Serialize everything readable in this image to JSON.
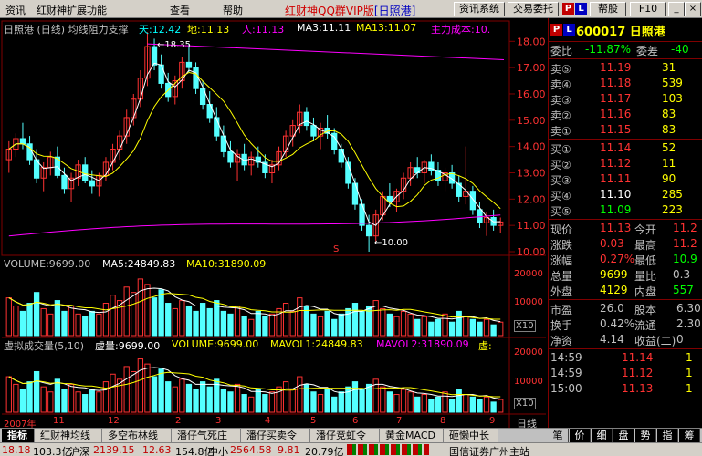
{
  "menu": {
    "items": [
      "资讯",
      "红财神扩展功能",
      "查看",
      "帮助"
    ],
    "caption_brand": "红财神QQ群VIP版",
    "caption_stock": "[日照港]",
    "buttons": [
      "资讯系统",
      "交易委托",
      "帮股",
      "F10"
    ],
    "p_badge": "P",
    "l_badge": "L"
  },
  "chart": {
    "title": "日照港 (日线) 均线阻力支撑",
    "legend": {
      "sky": "天:12.42",
      "earth": "地:11.13",
      "person": "人:11.13",
      "ma3": "MA3:11.11",
      "ma13": "MA13:11.07",
      "cost": "主力成本:10."
    },
    "price_axis": [
      "18.00",
      "17.00",
      "16.00",
      "15.00",
      "14.00",
      "13.00",
      "12.00",
      "11.00",
      "10.00"
    ],
    "high_label": "18.35",
    "low_label": "10.00",
    "marker_s": "S",
    "volume_legend": {
      "volume": "VOLUME:9699.00",
      "ma5": "MA5:24849.83",
      "ma10": "MA10:31890.09"
    },
    "volume_axis": [
      "20000",
      "10000"
    ],
    "volume_unit": "X10",
    "virtual_legend": {
      "title": "虚拟成交量(5,10)",
      "vol": "虚量:9699.00",
      "volume": "VOLUME:9699.00",
      "mavol1": "MAVOL1:24849.83",
      "mavol2": "MAVOL2:31890.09",
      "xu": "虚:"
    },
    "virtual_axis": [
      "20000",
      "10000"
    ],
    "virtual_unit": "X10",
    "date_labels": [
      "2007年",
      "11",
      "12",
      "2",
      "3",
      "4",
      "5",
      "6",
      "7",
      "8",
      "9"
    ],
    "period_label": "日线",
    "colors": {
      "up": "#ff3232",
      "down": "#54ffff",
      "ma_white": "#ffffff",
      "ma_yellow": "#ffff00",
      "ma_magenta": "#ff00ff"
    }
  },
  "chart_data": {
    "type": "candlestick",
    "title": "",
    "ylim": [
      10,
      18.6
    ],
    "volume_ylim": [
      0,
      23000
    ],
    "candles": [
      {
        "o": 13.5,
        "h": 14.2,
        "l": 13.0,
        "c": 13.9
      },
      {
        "o": 13.9,
        "h": 14.5,
        "l": 13.6,
        "c": 14.3
      },
      {
        "o": 14.3,
        "h": 14.9,
        "l": 13.9,
        "c": 14.1
      },
      {
        "o": 14.1,
        "h": 14.4,
        "l": 13.3,
        "c": 13.5
      },
      {
        "o": 13.5,
        "h": 13.9,
        "l": 12.6,
        "c": 12.8
      },
      {
        "o": 12.8,
        "h": 13.4,
        "l": 12.3,
        "c": 13.2
      },
      {
        "o": 13.2,
        "h": 13.8,
        "l": 12.9,
        "c": 13.6
      },
      {
        "o": 13.6,
        "h": 14.0,
        "l": 12.8,
        "c": 12.9
      },
      {
        "o": 12.9,
        "h": 13.2,
        "l": 12.2,
        "c": 12.4
      },
      {
        "o": 12.4,
        "h": 13.0,
        "l": 11.9,
        "c": 12.8
      },
      {
        "o": 12.8,
        "h": 13.5,
        "l": 12.5,
        "c": 13.3
      },
      {
        "o": 13.3,
        "h": 13.6,
        "l": 12.6,
        "c": 12.7
      },
      {
        "o": 12.7,
        "h": 13.1,
        "l": 12.2,
        "c": 12.5
      },
      {
        "o": 12.5,
        "h": 13.0,
        "l": 12.1,
        "c": 12.9
      },
      {
        "o": 12.9,
        "h": 13.6,
        "l": 12.7,
        "c": 13.4
      },
      {
        "o": 13.4,
        "h": 14.1,
        "l": 13.1,
        "c": 13.9
      },
      {
        "o": 13.9,
        "h": 14.6,
        "l": 13.5,
        "c": 14.4
      },
      {
        "o": 14.4,
        "h": 15.4,
        "l": 14.1,
        "c": 15.1
      },
      {
        "o": 15.1,
        "h": 16.0,
        "l": 14.8,
        "c": 15.8
      },
      {
        "o": 15.8,
        "h": 16.9,
        "l": 15.5,
        "c": 16.6
      },
      {
        "o": 16.6,
        "h": 18.35,
        "l": 16.3,
        "c": 17.8
      },
      {
        "o": 17.8,
        "h": 18.1,
        "l": 16.9,
        "c": 17.1
      },
      {
        "o": 17.1,
        "h": 17.5,
        "l": 16.2,
        "c": 16.4
      },
      {
        "o": 16.4,
        "h": 16.8,
        "l": 15.7,
        "c": 15.9
      },
      {
        "o": 15.9,
        "h": 16.7,
        "l": 15.6,
        "c": 16.5
      },
      {
        "o": 16.5,
        "h": 17.4,
        "l": 16.2,
        "c": 17.2
      },
      {
        "o": 17.2,
        "h": 17.9,
        "l": 16.8,
        "c": 17.0
      },
      {
        "o": 17.0,
        "h": 17.2,
        "l": 16.0,
        "c": 16.2
      },
      {
        "o": 16.2,
        "h": 16.5,
        "l": 15.4,
        "c": 15.6
      },
      {
        "o": 15.6,
        "h": 16.1,
        "l": 14.9,
        "c": 15.1
      },
      {
        "o": 15.1,
        "h": 15.5,
        "l": 14.2,
        "c": 14.4
      },
      {
        "o": 14.4,
        "h": 14.8,
        "l": 13.6,
        "c": 13.8
      },
      {
        "o": 13.8,
        "h": 14.2,
        "l": 13.2,
        "c": 13.4
      },
      {
        "o": 13.4,
        "h": 13.9,
        "l": 12.7,
        "c": 13.7
      },
      {
        "o": 13.7,
        "h": 14.1,
        "l": 13.1,
        "c": 13.3
      },
      {
        "o": 13.3,
        "h": 13.8,
        "l": 12.9,
        "c": 13.6
      },
      {
        "o": 13.6,
        "h": 14.0,
        "l": 13.2,
        "c": 13.4
      },
      {
        "o": 13.4,
        "h": 13.7,
        "l": 12.8,
        "c": 13.0
      },
      {
        "o": 13.0,
        "h": 13.5,
        "l": 12.6,
        "c": 13.3
      },
      {
        "o": 13.3,
        "h": 14.0,
        "l": 13.1,
        "c": 13.8
      },
      {
        "o": 13.8,
        "h": 14.6,
        "l": 13.6,
        "c": 14.4
      },
      {
        "o": 14.4,
        "h": 15.0,
        "l": 14.0,
        "c": 14.8
      },
      {
        "o": 14.8,
        "h": 15.6,
        "l": 14.5,
        "c": 15.3
      },
      {
        "o": 15.3,
        "h": 15.5,
        "l": 14.6,
        "c": 14.8
      },
      {
        "o": 14.8,
        "h": 15.1,
        "l": 14.2,
        "c": 14.4
      },
      {
        "o": 14.4,
        "h": 14.9,
        "l": 13.9,
        "c": 14.7
      },
      {
        "o": 14.7,
        "h": 15.2,
        "l": 14.3,
        "c": 14.5
      },
      {
        "o": 14.5,
        "h": 14.7,
        "l": 13.7,
        "c": 13.9
      },
      {
        "o": 13.9,
        "h": 14.1,
        "l": 13.2,
        "c": 13.4
      },
      {
        "o": 13.4,
        "h": 13.6,
        "l": 12.4,
        "c": 12.6
      },
      {
        "o": 12.6,
        "h": 12.8,
        "l": 11.6,
        "c": 11.8
      },
      {
        "o": 11.8,
        "h": 12.0,
        "l": 10.8,
        "c": 11.0
      },
      {
        "o": 11.0,
        "h": 11.4,
        "l": 10.0,
        "c": 10.6
      },
      {
        "o": 10.6,
        "h": 11.6,
        "l": 10.4,
        "c": 11.4
      },
      {
        "o": 11.4,
        "h": 12.3,
        "l": 11.2,
        "c": 12.1
      },
      {
        "o": 12.1,
        "h": 12.6,
        "l": 11.7,
        "c": 11.9
      },
      {
        "o": 11.9,
        "h": 12.4,
        "l": 11.5,
        "c": 12.3
      },
      {
        "o": 12.3,
        "h": 13.0,
        "l": 12.0,
        "c": 12.8
      },
      {
        "o": 12.8,
        "h": 13.4,
        "l": 12.5,
        "c": 13.2
      },
      {
        "o": 13.2,
        "h": 13.6,
        "l": 12.8,
        "c": 13.0
      },
      {
        "o": 13.0,
        "h": 13.5,
        "l": 12.6,
        "c": 13.4
      },
      {
        "o": 13.4,
        "h": 13.7,
        "l": 12.9,
        "c": 13.1
      },
      {
        "o": 13.1,
        "h": 13.4,
        "l": 12.5,
        "c": 12.7
      },
      {
        "o": 12.7,
        "h": 13.2,
        "l": 12.3,
        "c": 13.0
      },
      {
        "o": 13.0,
        "h": 13.3,
        "l": 12.4,
        "c": 12.6
      },
      {
        "o": 12.6,
        "h": 12.9,
        "l": 11.9,
        "c": 12.1
      },
      {
        "o": 12.1,
        "h": 14.0,
        "l": 11.8,
        "c": 12.3
      },
      {
        "o": 12.3,
        "h": 12.5,
        "l": 11.4,
        "c": 11.6
      },
      {
        "o": 11.6,
        "h": 11.9,
        "l": 10.9,
        "c": 11.1
      },
      {
        "o": 11.1,
        "h": 11.5,
        "l": 10.6,
        "c": 11.3
      },
      {
        "o": 11.3,
        "h": 11.6,
        "l": 10.8,
        "c": 11.0
      },
      {
        "o": 11.0,
        "h": 11.3,
        "l": 10.7,
        "c": 11.13
      }
    ],
    "volumes": [
      14000,
      11000,
      9000,
      12000,
      16000,
      10000,
      8000,
      13000,
      9000,
      11000,
      8000,
      7000,
      9000,
      8000,
      12000,
      15000,
      13000,
      18000,
      16000,
      21000,
      19000,
      14000,
      17000,
      12000,
      10000,
      13000,
      11000,
      9000,
      12000,
      10000,
      13000,
      9000,
      8000,
      11000,
      7000,
      6000,
      9000,
      7000,
      8000,
      10000,
      12000,
      9000,
      14000,
      11000,
      8000,
      7000,
      9000,
      6000,
      8000,
      10000,
      12000,
      9000,
      11000,
      13000,
      10000,
      8000,
      7000,
      9000,
      8000,
      6000,
      7000,
      5000,
      6000,
      8000,
      5000,
      9000,
      7000,
      6000,
      5000,
      6000,
      4000,
      5000
    ]
  },
  "quote": {
    "code": "600017 日照港",
    "p_badge": "P",
    "wb": {
      "label": "委比",
      "value": "-11.87%",
      "label2": "委差",
      "value2": "-40"
    },
    "asks": [
      {
        "label": "卖⑤",
        "price": "11.19",
        "vol": "31"
      },
      {
        "label": "卖④",
        "price": "11.18",
        "vol": "539"
      },
      {
        "label": "卖③",
        "price": "11.17",
        "vol": "103"
      },
      {
        "label": "卖②",
        "price": "11.16",
        "vol": "83"
      },
      {
        "label": "卖①",
        "price": "11.15",
        "vol": "83"
      }
    ],
    "bids": [
      {
        "label": "买①",
        "price": "11.14",
        "vol": "52"
      },
      {
        "label": "买②",
        "price": "11.12",
        "vol": "11"
      },
      {
        "label": "买③",
        "price": "11.11",
        "vol": "90"
      },
      {
        "label": "买④",
        "price": "11.10",
        "vol": "285"
      },
      {
        "label": "买⑤",
        "price": "11.09",
        "vol": "223"
      }
    ],
    "stats": [
      {
        "l1": "现价",
        "v1": "11.13",
        "l2": "今开",
        "v2": "11.2"
      },
      {
        "l1": "涨跌",
        "v1": "0.03",
        "l2": "最高",
        "v2": "11.2"
      },
      {
        "l1": "涨幅",
        "v1": "0.27%",
        "l2": "最低",
        "v2": "10.9"
      },
      {
        "l1": "总量",
        "v1": "9699",
        "l2": "量比",
        "v2": "0.3"
      },
      {
        "l1": "外盘",
        "v1": "4129",
        "l2": "内盘",
        "v2": "557"
      }
    ],
    "stats2": [
      {
        "l1": "市盈",
        "v1": "26.0",
        "l2": "股本",
        "v2": "6.30"
      },
      {
        "l1": "换手",
        "v1": "0.42%",
        "l2": "流通",
        "v2": "2.30"
      },
      {
        "l1": "净资",
        "v1": "4.14",
        "l2": "收益(二)",
        "v2": "0"
      }
    ],
    "ticks": [
      {
        "time": "14:59",
        "price": "11.14",
        "vol": "1"
      },
      {
        "time": "14:59",
        "price": "11.12",
        "vol": "1"
      },
      {
        "time": "15:00",
        "price": "11.13",
        "vol": "1"
      }
    ]
  },
  "tabs": {
    "bottom": [
      "指标",
      "红财神均线",
      "多空布林线",
      "潘仔气死庄",
      "潘仔买卖令",
      "潘仔竞虹令",
      "黄金MACD",
      "砸懒中长"
    ],
    "side": [
      "笔",
      "价",
      "细",
      "盘",
      "势",
      "指",
      "筹"
    ]
  },
  "status": {
    "sh_val": "18.18",
    "sh_amount": "103.3亿",
    "sz_label": "沪深",
    "sz_val": "2139.15",
    "sz_chg": "12.63",
    "sz_amount": "154.8亿",
    "sme_label": "中小",
    "sme_val": "2564.58",
    "sme_chg": "9.81",
    "sme_pct": "20.79亿",
    "broker": "国信证券广州主站"
  }
}
